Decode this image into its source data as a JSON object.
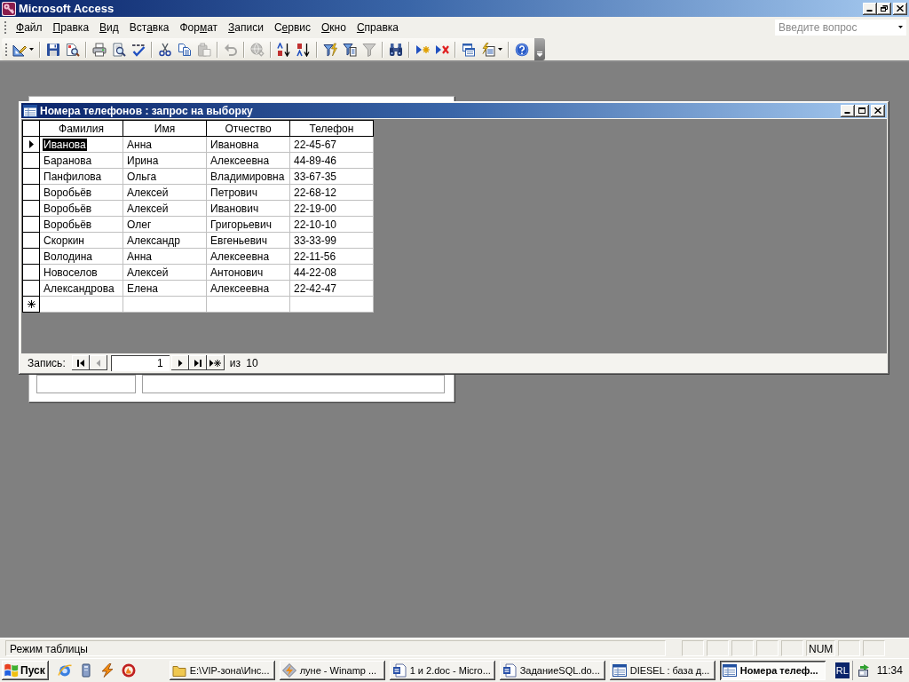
{
  "app_window": {
    "title": "Microsoft Access",
    "controls": [
      {
        "kind": "minimize"
      },
      {
        "kind": "restore"
      },
      {
        "kind": "close"
      }
    ]
  },
  "menu_bar": {
    "items": [
      {
        "access_key": "Ф",
        "after": "айл"
      },
      {
        "access_key": "П",
        "after": "равка"
      },
      {
        "access_key": "В",
        "after": "ид"
      },
      {
        "before": "Вст",
        "access_key": "а",
        "after": "вка"
      },
      {
        "before": "Фор",
        "access_key": "м",
        "after": "ат"
      },
      {
        "access_key": "З",
        "after": "аписи"
      },
      {
        "before": "С",
        "access_key": "е",
        "after": "рвис"
      },
      {
        "access_key": "О",
        "after": "кно"
      },
      {
        "access_key": "С",
        "after": "правка"
      }
    ],
    "help_search": {
      "placeholder": "Введите вопрос"
    }
  },
  "toolbar": {
    "groups": [
      {
        "buttons": [
          {
            "kind": "design-view",
            "disabled": false,
            "has_menu": true
          }
        ]
      },
      {
        "buttons": [
          {
            "kind": "save",
            "disabled": false,
            "has_menu": false
          },
          {
            "kind": "file-search",
            "disabled": false,
            "has_menu": false
          }
        ]
      },
      {
        "buttons": [
          {
            "kind": "print",
            "disabled": false,
            "has_menu": false
          },
          {
            "kind": "print-preview",
            "disabled": false,
            "has_menu": false
          },
          {
            "kind": "spelling",
            "disabled": false,
            "has_menu": false
          }
        ]
      },
      {
        "buttons": [
          {
            "kind": "cut",
            "disabled": false,
            "has_menu": false
          },
          {
            "kind": "copy",
            "disabled": false,
            "has_menu": false
          },
          {
            "kind": "paste",
            "disabled": true,
            "has_menu": false
          }
        ]
      },
      {
        "buttons": [
          {
            "kind": "undo",
            "disabled": true,
            "has_menu": false
          }
        ]
      },
      {
        "buttons": [
          {
            "kind": "hyperlink",
            "disabled": true,
            "has_menu": false
          }
        ]
      },
      {
        "buttons": [
          {
            "kind": "sort-ascending",
            "disabled": false,
            "has_menu": false
          },
          {
            "kind": "sort-descending",
            "disabled": false,
            "has_menu": false
          }
        ]
      },
      {
        "buttons": [
          {
            "kind": "filter-by-selection",
            "disabled": false,
            "has_menu": false
          },
          {
            "kind": "filter-by-form",
            "disabled": false,
            "has_menu": false
          },
          {
            "kind": "apply-filter",
            "disabled": true,
            "has_menu": false
          }
        ]
      },
      {
        "buttons": [
          {
            "kind": "find",
            "disabled": false,
            "has_menu": false
          }
        ]
      },
      {
        "buttons": [
          {
            "kind": "new-record",
            "disabled": false,
            "has_menu": false
          },
          {
            "kind": "delete-record",
            "disabled": false,
            "has_menu": false
          }
        ]
      },
      {
        "buttons": [
          {
            "kind": "database-window",
            "disabled": false,
            "has_menu": false
          },
          {
            "kind": "new-object",
            "disabled": false,
            "has_menu": true
          }
        ]
      },
      {
        "buttons": [
          {
            "kind": "help",
            "disabled": false,
            "has_menu": false
          }
        ]
      }
    ],
    "overflow_button": true
  },
  "form_window": {
    "text_boxes": [
      {
        "kind": "short"
      },
      {
        "kind": "long"
      }
    ]
  },
  "query_window": {
    "title": "Номера телефонов : запрос на выборку",
    "controls": [
      {
        "kind": "minimize"
      },
      {
        "kind": "maximize"
      },
      {
        "kind": "close"
      }
    ],
    "columns": [
      "Фамилия",
      "Имя",
      "Отчество",
      "Телефон"
    ],
    "rows": [
      {
        "kind": "record",
        "current": true,
        "cells": [
          {
            "text": "Иванова",
            "selected": true
          },
          {
            "text": "Анна",
            "selected": false
          },
          {
            "text": "Ивановна",
            "selected": false
          },
          {
            "text": "22-45-67",
            "selected": false
          }
        ]
      },
      {
        "kind": "record",
        "current": false,
        "cells": [
          {
            "text": "Баранова",
            "selected": false
          },
          {
            "text": "Ирина",
            "selected": false
          },
          {
            "text": "Алексеевна",
            "selected": false
          },
          {
            "text": "44-89-46",
            "selected": false
          }
        ]
      },
      {
        "kind": "record",
        "current": false,
        "cells": [
          {
            "text": "Панфилова",
            "selected": false
          },
          {
            "text": "Ольга",
            "selected": false
          },
          {
            "text": "Владимировна",
            "selected": false
          },
          {
            "text": "33-67-35",
            "selected": false
          }
        ]
      },
      {
        "kind": "record",
        "current": false,
        "cells": [
          {
            "text": "Воробьёв",
            "selected": false
          },
          {
            "text": "Алексей",
            "selected": false
          },
          {
            "text": "Петрович",
            "selected": false
          },
          {
            "text": "22-68-12",
            "selected": false
          }
        ]
      },
      {
        "kind": "record",
        "current": false,
        "cells": [
          {
            "text": "Воробьёв",
            "selected": false
          },
          {
            "text": "Алексей",
            "selected": false
          },
          {
            "text": "Иванович",
            "selected": false
          },
          {
            "text": "22-19-00",
            "selected": false
          }
        ]
      },
      {
        "kind": "record",
        "current": false,
        "cells": [
          {
            "text": "Воробьёв",
            "selected": false
          },
          {
            "text": "Олег",
            "selected": false
          },
          {
            "text": "Григорьевич",
            "selected": false
          },
          {
            "text": "22-10-10",
            "selected": false
          }
        ]
      },
      {
        "kind": "record",
        "current": false,
        "cells": [
          {
            "text": "Скоркин",
            "selected": false
          },
          {
            "text": "Александр",
            "selected": false
          },
          {
            "text": "Евгеньевич",
            "selected": false
          },
          {
            "text": "33-33-99",
            "selected": false
          }
        ]
      },
      {
        "kind": "record",
        "current": false,
        "cells": [
          {
            "text": "Володина",
            "selected": false
          },
          {
            "text": "Анна",
            "selected": false
          },
          {
            "text": "Алексеевна",
            "selected": false
          },
          {
            "text": "22-11-56",
            "selected": false
          }
        ]
      },
      {
        "kind": "record",
        "current": false,
        "cells": [
          {
            "text": "Новоселов",
            "selected": false
          },
          {
            "text": "Алексей",
            "selected": false
          },
          {
            "text": "Антонович",
            "selected": false
          },
          {
            "text": "44-22-08",
            "selected": false
          }
        ]
      },
      {
        "kind": "record",
        "current": false,
        "cells": [
          {
            "text": "Александрова",
            "selected": false
          },
          {
            "text": "Елена",
            "selected": false
          },
          {
            "text": "Алексеевна",
            "selected": false
          },
          {
            "text": "22-42-47",
            "selected": false
          }
        ]
      },
      {
        "kind": "new",
        "current": false
      }
    ],
    "navigation": {
      "label": "Запись:",
      "back_buttons": [
        {
          "kind": "first",
          "disabled": false
        },
        {
          "kind": "previous",
          "disabled": true
        }
      ],
      "record_number": "1",
      "forward_buttons": [
        {
          "kind": "next",
          "disabled": false
        },
        {
          "kind": "last",
          "disabled": false
        },
        {
          "kind": "new",
          "disabled": false
        }
      ],
      "total": "из 10"
    }
  },
  "status_bar": {
    "text": "Режим таблицы",
    "panes": [
      {
        "kind": "blank"
      },
      {
        "kind": "blank"
      },
      {
        "kind": "blank"
      },
      {
        "kind": "blank"
      },
      {
        "kind": "blank"
      },
      {
        "kind": "label",
        "label": "NUM"
      },
      {
        "kind": "blank"
      },
      {
        "kind": "blank"
      }
    ]
  },
  "taskbar": {
    "start_label": "Пуск",
    "quick_launch": [
      {
        "kind": "browser"
      },
      {
        "kind": "computer"
      },
      {
        "kind": "player"
      },
      {
        "kind": "media"
      }
    ],
    "tasks": [
      {
        "kind": "folder",
        "label": "E:\\VIP-зона\\Инс...",
        "selected": false
      },
      {
        "kind": "player",
        "label": "луне - Winamp ...",
        "selected": false
      },
      {
        "kind": "document",
        "label": "1 и 2.doc - Micro...",
        "selected": false
      },
      {
        "kind": "document",
        "label": "ЗаданиеSQL.do...",
        "selected": false
      },
      {
        "kind": "database",
        "label": "DIESEL : база д...",
        "selected": false
      },
      {
        "kind": "query",
        "label": "Номера телеф...",
        "selected": true
      }
    ],
    "language": "RL",
    "clock": "11:34"
  }
}
